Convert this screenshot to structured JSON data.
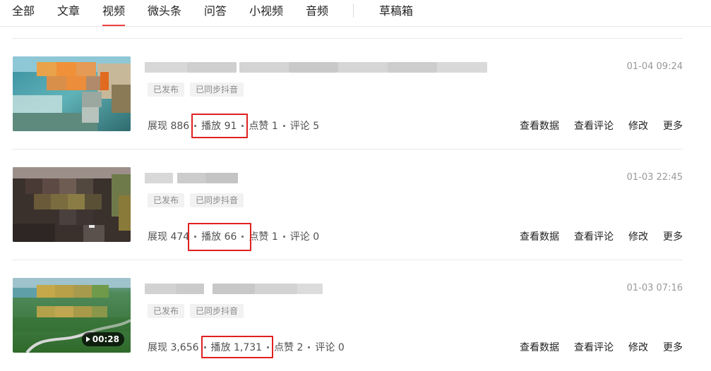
{
  "tabs": [
    {
      "label": "全部"
    },
    {
      "label": "文章"
    },
    {
      "label": "视频",
      "active": true
    },
    {
      "label": "微头条"
    },
    {
      "label": "问答"
    },
    {
      "label": "小视频"
    },
    {
      "label": "音频"
    },
    {
      "label": "草稿箱"
    }
  ],
  "videos": [
    {
      "time": "01-04 09:24",
      "badges": [
        "已发布",
        "已同步抖音"
      ],
      "stats": {
        "impressions": "展现 886",
        "plays": "播放 91",
        "likes": "点赞 1",
        "comments": "评论 5"
      },
      "duration": ""
    },
    {
      "time": "01-03 22:45",
      "badges": [
        "已发布",
        "已同步抖音"
      ],
      "stats": {
        "impressions": "展现 474",
        "plays": "播放 66",
        "likes": "点赞 1",
        "comments": "评论 0"
      },
      "duration": ""
    },
    {
      "time": "01-03 07:16",
      "badges": [
        "已发布",
        "已同步抖音"
      ],
      "stats": {
        "impressions": "展现 3,656",
        "plays": "播放 1,731",
        "likes": "点赞 2",
        "comments": "评论 0"
      },
      "duration": "00:28"
    }
  ],
  "actions": {
    "view_data": "查看数据",
    "view_comments": "查看评论",
    "edit": "修改",
    "more": "更多"
  },
  "colors": {
    "active_tab_underline": "#f04142",
    "highlight_box": "#e02020",
    "muted_text": "#999999",
    "badge_bg": "#f2f2f2"
  }
}
